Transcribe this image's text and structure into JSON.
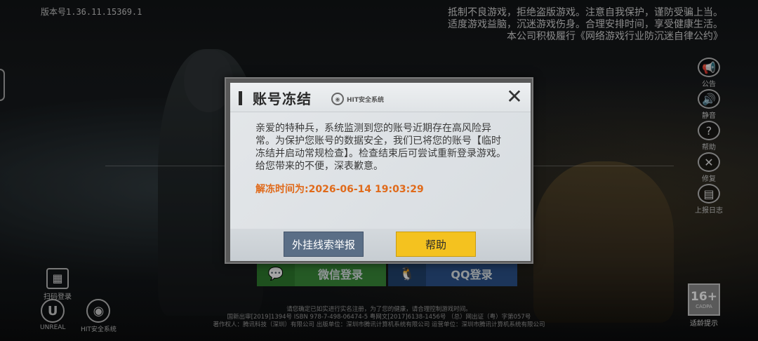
{
  "version": "版本号1.36.11.15369.1",
  "notice_lines": [
    "抵制不良游戏，拒绝盗版游戏。注意自我保护，谨防受骗上当。",
    "适度游戏益脑，沉迷游戏伤身。合理安排时间，享受健康生活。",
    "本公司积极履行《网络游戏行业防沉迷自律公约》"
  ],
  "tools": [
    {
      "icon": "megaphone-icon",
      "glyph": "📢",
      "label": "公告"
    },
    {
      "icon": "speaker-icon",
      "glyph": "🔊",
      "label": "静音"
    },
    {
      "icon": "help-icon",
      "glyph": "?",
      "label": "帮助"
    },
    {
      "icon": "wrench-icon",
      "glyph": "✕",
      "label": "修复"
    },
    {
      "icon": "clipboard-icon",
      "glyph": "▤",
      "label": "上报日志"
    }
  ],
  "login": {
    "wechat_label": "微信登录",
    "qq_label": "QQ登录"
  },
  "scan_label": "扫码登录",
  "logos": {
    "unreal": "UNREAL",
    "hit": "HIT安全系统"
  },
  "footer_lines": [
    "请您确定已如实进行实名注册，为了您的健康，请合理控制游戏时间。",
    "国新出审[2019]1394号  ISBN 978-7-498-06474-5  粤网文[2017]6138-1456号 （总）网出证（粤）字第057号",
    "著作权人：腾讯科技（深圳）有限公司   出版单位：深圳市腾讯计算机系统有限公司   运营单位：深圳市腾讯计算机系统有限公司"
  ],
  "age_rating": {
    "value": "16+",
    "sub": "CADPA",
    "label": "适龄提示"
  },
  "dialog": {
    "title": "账号冻结",
    "brand": "HIT安全系统",
    "close_glyph": "✕",
    "message": "亲爱的特种兵，系统监测到您的账号近期存在高风险异常。为保护您账号的数据安全，我们已将您的账号【临时冻结并启动常规检查】。检查结束后可尝试重新登录游戏。给您带来的不便，深表歉意。",
    "unfreeze_label": "解冻时间为:",
    "unfreeze_time": "2026-06-14 19:03:29",
    "report_button": "外挂线索举报",
    "help_button": "帮助"
  },
  "colors": {
    "accent_orange": "#e06a1a",
    "help_yellow": "#f4c21f",
    "report_blue": "#5a6e86"
  }
}
